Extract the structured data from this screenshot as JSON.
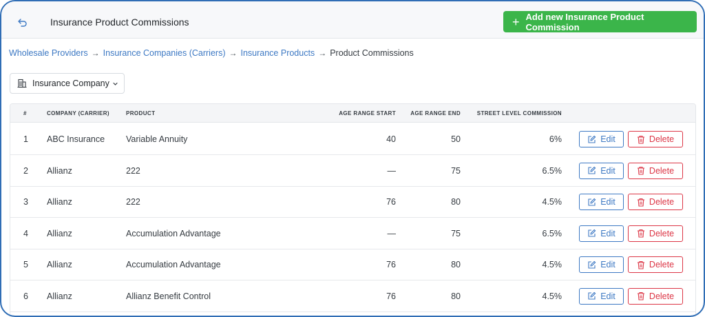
{
  "header": {
    "title": "Insurance Product Commissions",
    "add_button_label": "Add new Insurance Product Commission",
    "accent_color": "#3bb54a"
  },
  "breadcrumb": {
    "items": [
      "Wholesale Providers",
      "Insurance Companies (Carriers)",
      "Insurance Products"
    ],
    "current": "Product Commissions",
    "separator": "→"
  },
  "filter": {
    "label": "Insurance Company"
  },
  "table": {
    "columns": [
      "#",
      "Company (Carrier)",
      "Product",
      "Age Range Start",
      "Age Range End",
      "Street Level Commission"
    ],
    "edit_label": "Edit",
    "delete_label": "Delete",
    "rows": [
      {
        "num": "1",
        "company": "ABC Insurance",
        "product": "Variable Annuity",
        "age_start": "40",
        "age_end": "50",
        "commission": "6%"
      },
      {
        "num": "2",
        "company": "Allianz",
        "product": "222",
        "age_start": "—",
        "age_end": "75",
        "commission": "6.5%"
      },
      {
        "num": "3",
        "company": "Allianz",
        "product": "222",
        "age_start": "76",
        "age_end": "80",
        "commission": "4.5%"
      },
      {
        "num": "4",
        "company": "Allianz",
        "product": "Accumulation Advantage",
        "age_start": "—",
        "age_end": "75",
        "commission": "6.5%"
      },
      {
        "num": "5",
        "company": "Allianz",
        "product": "Accumulation Advantage",
        "age_start": "76",
        "age_end": "80",
        "commission": "4.5%"
      },
      {
        "num": "6",
        "company": "Allianz",
        "product": "Allianz Benefit Control",
        "age_start": "76",
        "age_end": "80",
        "commission": "4.5%"
      }
    ]
  },
  "colors": {
    "link": "#3c78c3",
    "danger": "#dc3545",
    "success": "#3bb54a"
  }
}
